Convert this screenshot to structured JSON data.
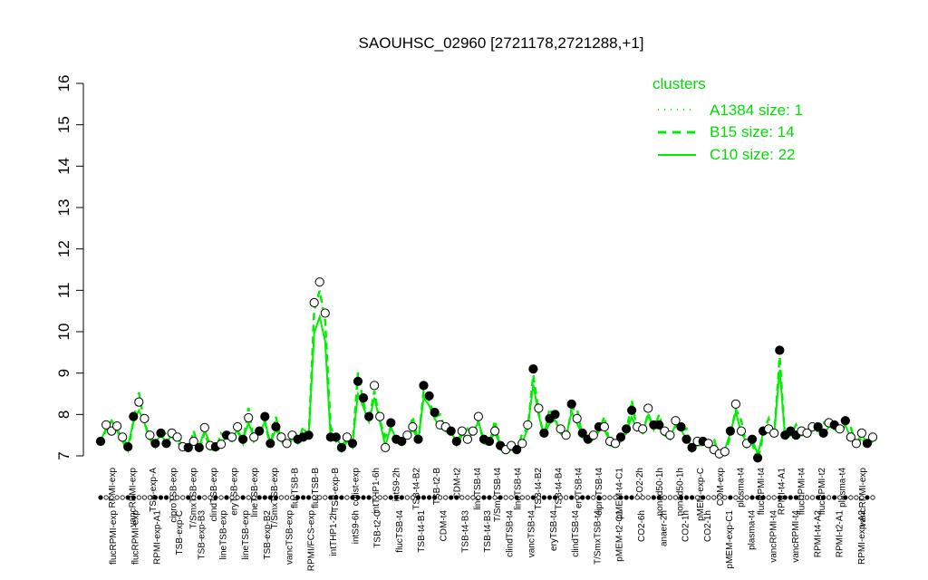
{
  "chart_data": {
    "type": "line",
    "title": "SAOUHSC_02960 [2721178,2721288,+1]",
    "ylim": [
      7,
      16
    ],
    "yticks": [
      7,
      8,
      9,
      10,
      11,
      12,
      13,
      14,
      15,
      16
    ],
    "legend": {
      "title": "clusters",
      "position": "top-right",
      "entries": [
        "A1384 size: 1",
        "B15 size: 14",
        "C10 size: 22"
      ],
      "styles": [
        "dotted",
        "dashed",
        "solid"
      ]
    },
    "series_color": "#00ee00",
    "top_labels": [
      "RPMI-exp",
      "vancRPMI-exp",
      "TSB-exp-A",
      "ciproTSB-exp",
      "T/SmxTSB-exp",
      "clindTSB-exp",
      "eryTSB-exp",
      "lineTSB-exp",
      "T/SmxTSB-exp",
      "flucTSB-B",
      "flucTSB-B",
      "TSB-exp-B",
      "colist-exp",
      "intTHP1-6h",
      "intS9-2h",
      "TSB-t4-B2",
      "TSB-t2-B",
      "CDM-t2",
      "lineTSB-t4",
      "T/SmxTSB-t4",
      "lineTSB-t4",
      "TSB-t4-B2",
      "TSB-t4-B4",
      "eryTSB-t4",
      "ciproTSB-t4",
      "pMEM-t4-C1",
      "CO2-2h",
      "nonad50-1h",
      "nonad50-1h",
      "pMEM-exp-C",
      "CDM-exp",
      "plasma-t4",
      "flucRPMI-t4",
      "RPMI-t4-A1",
      "flucRPMI-t4",
      "flucRPMI-t2",
      "plasma-t4",
      "vancRPMI-exp"
    ],
    "bottom_labels": [
      "flucRPMI-exp",
      "flucRPMI-exp",
      "RPMI-exp-A1",
      "TSB-exp-C",
      "TSB-exp-B3",
      "lineTSB-exp",
      "lineTSB-exp",
      "TSB-exp-B2",
      "vancTSB-exp",
      "RPMI/FCS-exp",
      "intTHP1-2h",
      "intS9-6h",
      "TSB-t2-C",
      "flucTSB-t4",
      "TSB-t4-B1",
      "CDM-t4",
      "TSB-t4-B3",
      "TSB-t4-B3",
      "clindTSB-t4",
      "vancTSB-t4",
      "eryTSB-t4",
      "clindTSB-t4",
      "T/SmxTSB-t4",
      "pMEM-t2-C1",
      "CO2-6h",
      "anaer-2h",
      "CO2-1h",
      "CO2-1h",
      "pMEM-exp-C1",
      "plasma-t4",
      "vancRPMI-t4",
      "vancRPMI-t4",
      "RPMI-t4-A2",
      "RPMI-t2-A1",
      "RPMI-exp-A2"
    ],
    "points": [
      {
        "y": 7.35,
        "f": 1
      },
      {
        "y": 7.75,
        "f": 0
      },
      {
        "y": 7.6,
        "f": 0
      },
      {
        "y": 7.72,
        "f": 0
      },
      {
        "y": 7.45,
        "f": 0
      },
      {
        "y": 7.22,
        "f": 1
      },
      {
        "y": 7.95,
        "f": 1
      },
      {
        "y": 8.3,
        "f": 0
      },
      {
        "y": 7.9,
        "f": 0
      },
      {
        "y": 7.5,
        "f": 0
      },
      {
        "y": 7.3,
        "f": 1
      },
      {
        "y": 7.55,
        "f": 1
      },
      {
        "y": 7.3,
        "f": 1
      },
      {
        "y": 7.55,
        "f": 0
      },
      {
        "y": 7.45,
        "f": 0
      },
      {
        "y": 7.22,
        "f": 0
      },
      {
        "y": 7.2,
        "f": 1
      },
      {
        "y": 7.35,
        "f": 0
      },
      {
        "y": 7.2,
        "f": 1
      },
      {
        "y": 7.68,
        "f": 0
      },
      {
        "y": 7.25,
        "f": 0
      },
      {
        "y": 7.22,
        "f": 1
      },
      {
        "y": 7.28,
        "f": 0
      },
      {
        "y": 7.5,
        "f": 1
      },
      {
        "y": 7.45,
        "f": 0
      },
      {
        "y": 7.7,
        "f": 0
      },
      {
        "y": 7.4,
        "f": 1
      },
      {
        "y": 7.92,
        "f": 0
      },
      {
        "y": 7.45,
        "f": 0
      },
      {
        "y": 7.6,
        "f": 1
      },
      {
        "y": 7.95,
        "f": 1
      },
      {
        "y": 7.3,
        "f": 1
      },
      {
        "y": 7.7,
        "f": 1
      },
      {
        "y": 7.45,
        "f": 0
      },
      {
        "y": 7.3,
        "f": 0
      },
      {
        "y": 7.5,
        "f": 0
      },
      {
        "y": 7.4,
        "f": 1
      },
      {
        "y": 7.45,
        "f": 1
      },
      {
        "y": 7.5,
        "f": 1
      },
      {
        "y": 10.7,
        "f": 0
      },
      {
        "y": 11.2,
        "f": 0
      },
      {
        "y": 10.45,
        "f": 0
      },
      {
        "y": 7.45,
        "f": 1
      },
      {
        "y": 7.45,
        "f": 1
      },
      {
        "y": 7.2,
        "f": 1
      },
      {
        "y": 7.45,
        "f": 0
      },
      {
        "y": 7.3,
        "f": 1
      },
      {
        "y": 8.8,
        "f": 1
      },
      {
        "y": 8.4,
        "f": 1
      },
      {
        "y": 7.95,
        "f": 1
      },
      {
        "y": 8.7,
        "f": 0
      },
      {
        "y": 7.95,
        "f": 0
      },
      {
        "y": 7.2,
        "f": 0
      },
      {
        "y": 7.8,
        "f": 1
      },
      {
        "y": 7.4,
        "f": 1
      },
      {
        "y": 7.35,
        "f": 1
      },
      {
        "y": 7.5,
        "f": 0
      },
      {
        "y": 7.7,
        "f": 0
      },
      {
        "y": 7.4,
        "f": 1
      },
      {
        "y": 8.7,
        "f": 1
      },
      {
        "y": 8.45,
        "f": 1
      },
      {
        "y": 8.05,
        "f": 1
      },
      {
        "y": 7.75,
        "f": 0
      },
      {
        "y": 7.7,
        "f": 0
      },
      {
        "y": 7.6,
        "f": 1
      },
      {
        "y": 7.35,
        "f": 1
      },
      {
        "y": 7.6,
        "f": 0
      },
      {
        "y": 7.4,
        "f": 0
      },
      {
        "y": 7.6,
        "f": 0
      },
      {
        "y": 7.95,
        "f": 0
      },
      {
        "y": 7.4,
        "f": 1
      },
      {
        "y": 7.35,
        "f": 1
      },
      {
        "y": 7.6,
        "f": 0
      },
      {
        "y": 7.25,
        "f": 1
      },
      {
        "y": 7.15,
        "f": 0
      },
      {
        "y": 7.25,
        "f": 0
      },
      {
        "y": 7.15,
        "f": 1
      },
      {
        "y": 7.3,
        "f": 0
      },
      {
        "y": 7.75,
        "f": 0
      },
      {
        "y": 9.1,
        "f": 1
      },
      {
        "y": 8.15,
        "f": 0
      },
      {
        "y": 7.55,
        "f": 1
      },
      {
        "y": 7.9,
        "f": 1
      },
      {
        "y": 8.0,
        "f": 1
      },
      {
        "y": 7.65,
        "f": 0
      },
      {
        "y": 7.5,
        "f": 0
      },
      {
        "y": 8.25,
        "f": 1
      },
      {
        "y": 7.9,
        "f": 0
      },
      {
        "y": 7.55,
        "f": 1
      },
      {
        "y": 7.4,
        "f": 1
      },
      {
        "y": 7.5,
        "f": 0
      },
      {
        "y": 7.7,
        "f": 1
      },
      {
        "y": 7.7,
        "f": 0
      },
      {
        "y": 7.35,
        "f": 0
      },
      {
        "y": 7.3,
        "f": 0
      },
      {
        "y": 7.45,
        "f": 1
      },
      {
        "y": 7.65,
        "f": 1
      },
      {
        "y": 8.1,
        "f": 1
      },
      {
        "y": 7.7,
        "f": 0
      },
      {
        "y": 7.65,
        "f": 0
      },
      {
        "y": 8.15,
        "f": 0
      },
      {
        "y": 7.75,
        "f": 1
      },
      {
        "y": 7.75,
        "f": 1
      },
      {
        "y": 7.6,
        "f": 0
      },
      {
        "y": 7.5,
        "f": 0
      },
      {
        "y": 7.85,
        "f": 0
      },
      {
        "y": 7.7,
        "f": 1
      },
      {
        "y": 7.4,
        "f": 1
      },
      {
        "y": 7.2,
        "f": 1
      },
      {
        "y": 7.35,
        "f": 0
      },
      {
        "y": 7.35,
        "f": 1
      },
      {
        "y": 7.3,
        "f": 0
      },
      {
        "y": 7.15,
        "f": 0
      },
      {
        "y": 7.05,
        "f": 0
      },
      {
        "y": 7.1,
        "f": 0
      },
      {
        "y": 7.6,
        "f": 1
      },
      {
        "y": 8.25,
        "f": 0
      },
      {
        "y": 7.6,
        "f": 0
      },
      {
        "y": 7.3,
        "f": 0
      },
      {
        "y": 7.4,
        "f": 1
      },
      {
        "y": 6.95,
        "f": 1
      },
      {
        "y": 7.6,
        "f": 1
      },
      {
        "y": 7.65,
        "f": 0
      },
      {
        "y": 7.55,
        "f": 0
      },
      {
        "y": 9.55,
        "f": 1
      },
      {
        "y": 7.5,
        "f": 1
      },
      {
        "y": 7.6,
        "f": 1
      },
      {
        "y": 7.5,
        "f": 1
      },
      {
        "y": 7.6,
        "f": 0
      },
      {
        "y": 7.55,
        "f": 0
      },
      {
        "y": 7.7,
        "f": 0
      },
      {
        "y": 7.7,
        "f": 1
      },
      {
        "y": 7.55,
        "f": 1
      },
      {
        "y": 7.8,
        "f": 0
      },
      {
        "y": 7.75,
        "f": 1
      },
      {
        "y": 7.65,
        "f": 0
      },
      {
        "y": 7.85,
        "f": 1
      },
      {
        "y": 7.45,
        "f": 0
      },
      {
        "y": 7.3,
        "f": 0
      },
      {
        "y": 7.55,
        "f": 0
      },
      {
        "y": 7.3,
        "f": 1
      },
      {
        "y": 7.45,
        "f": 0
      }
    ]
  }
}
